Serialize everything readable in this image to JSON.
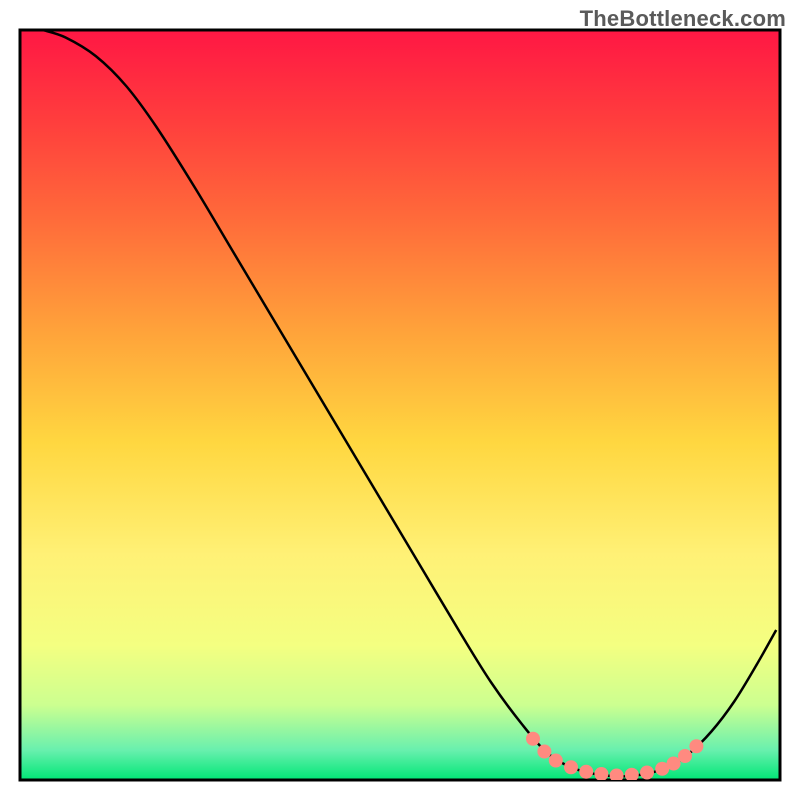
{
  "watermark": "TheBottleneck.com",
  "chart_data": {
    "type": "line",
    "title": "",
    "xlabel": "",
    "ylabel": "",
    "xlim": [
      0,
      100
    ],
    "ylim": [
      0,
      100
    ],
    "grid": false,
    "legend": false,
    "background": {
      "type": "vertical-gradient",
      "stops": [
        {
          "offset": 0.0,
          "color": "#ff1744"
        },
        {
          "offset": 0.12,
          "color": "#ff3d3d"
        },
        {
          "offset": 0.25,
          "color": "#ff6a3a"
        },
        {
          "offset": 0.4,
          "color": "#ffa23a"
        },
        {
          "offset": 0.55,
          "color": "#ffd740"
        },
        {
          "offset": 0.7,
          "color": "#fff176"
        },
        {
          "offset": 0.82,
          "color": "#f4ff81"
        },
        {
          "offset": 0.9,
          "color": "#ccff90"
        },
        {
          "offset": 0.96,
          "color": "#69f0ae"
        },
        {
          "offset": 1.0,
          "color": "#00e676"
        }
      ]
    },
    "series": [
      {
        "name": "curve",
        "type": "line",
        "color": "#000000",
        "width": 2.5,
        "points": [
          {
            "x": 3.0,
            "y": 100.0
          },
          {
            "x": 6.0,
            "y": 99.0
          },
          {
            "x": 10.0,
            "y": 96.5
          },
          {
            "x": 14.0,
            "y": 92.5
          },
          {
            "x": 18.0,
            "y": 87.0
          },
          {
            "x": 23.0,
            "y": 79.0
          },
          {
            "x": 28.0,
            "y": 70.5
          },
          {
            "x": 33.0,
            "y": 62.0
          },
          {
            "x": 38.0,
            "y": 53.5
          },
          {
            "x": 43.0,
            "y": 45.0
          },
          {
            "x": 48.0,
            "y": 36.5
          },
          {
            "x": 53.0,
            "y": 28.0
          },
          {
            "x": 58.0,
            "y": 19.5
          },
          {
            "x": 62.0,
            "y": 13.0
          },
          {
            "x": 66.0,
            "y": 7.5
          },
          {
            "x": 69.5,
            "y": 3.5
          },
          {
            "x": 73.0,
            "y": 1.5
          },
          {
            "x": 77.0,
            "y": 0.6
          },
          {
            "x": 81.0,
            "y": 0.6
          },
          {
            "x": 85.0,
            "y": 1.6
          },
          {
            "x": 88.0,
            "y": 3.5
          },
          {
            "x": 91.0,
            "y": 6.5
          },
          {
            "x": 94.0,
            "y": 10.5
          },
          {
            "x": 97.0,
            "y": 15.5
          },
          {
            "x": 99.5,
            "y": 20.0
          }
        ]
      },
      {
        "name": "markers",
        "type": "scatter",
        "color": "#ff8a80",
        "radius": 7,
        "points": [
          {
            "x": 67.5,
            "y": 5.5
          },
          {
            "x": 69.0,
            "y": 3.8
          },
          {
            "x": 70.5,
            "y": 2.6
          },
          {
            "x": 72.5,
            "y": 1.7
          },
          {
            "x": 74.5,
            "y": 1.1
          },
          {
            "x": 76.5,
            "y": 0.8
          },
          {
            "x": 78.5,
            "y": 0.6
          },
          {
            "x": 80.5,
            "y": 0.7
          },
          {
            "x": 82.5,
            "y": 1.0
          },
          {
            "x": 84.5,
            "y": 1.5
          },
          {
            "x": 86.0,
            "y": 2.2
          },
          {
            "x": 87.5,
            "y": 3.2
          },
          {
            "x": 89.0,
            "y": 4.5
          }
        ]
      }
    ]
  }
}
